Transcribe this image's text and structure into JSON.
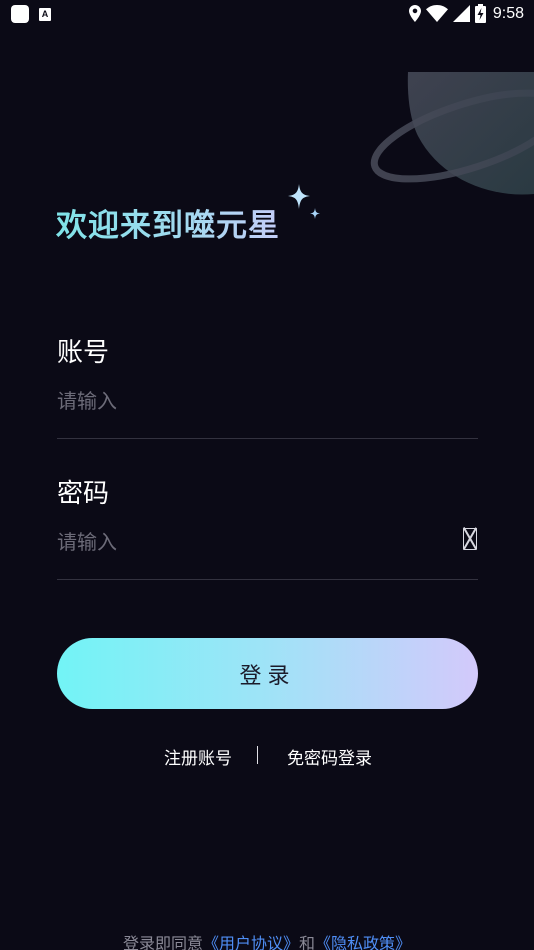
{
  "status_bar": {
    "time": "9:58",
    "left_icons": [
      "app-notification-icon",
      "accessibility-a-icon"
    ],
    "right_icons": [
      "location-icon",
      "wifi-icon",
      "signal-icon",
      "battery-charging-icon"
    ]
  },
  "welcome": {
    "title": "欢迎来到噬元星"
  },
  "account": {
    "label": "账号",
    "placeholder": "请输入"
  },
  "password": {
    "label": "密码",
    "placeholder": "请输入",
    "toggle_icon": "password-visibility-toggle-icon"
  },
  "login": {
    "label": "登录"
  },
  "links": {
    "register": "注册账号",
    "separator": "|",
    "no_password_login": "免密码登录"
  },
  "agreement": {
    "prefix": "登录即同意",
    "user_agreement": "《用户协议》",
    "and": "和",
    "privacy_policy": "《隐私政策》"
  },
  "colors": {
    "background": "#0b0a16",
    "button_gradient_start": "#72f4f6",
    "button_gradient_end": "#d3c9fb",
    "link_blue": "#4f8ef5",
    "placeholder": "#6c6b78"
  }
}
